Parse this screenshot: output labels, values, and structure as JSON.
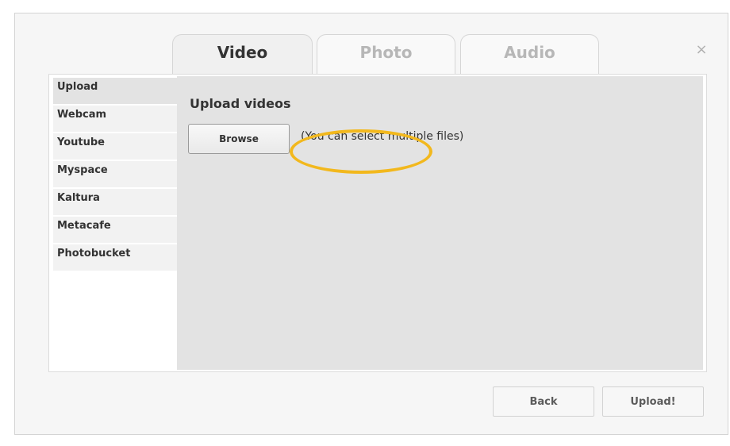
{
  "tabs": [
    {
      "label": "Video",
      "active": true
    },
    {
      "label": "Photo",
      "active": false
    },
    {
      "label": "Audio",
      "active": false
    }
  ],
  "close_symbol": "×",
  "sidebar": {
    "items": [
      {
        "label": "Upload",
        "active": true
      },
      {
        "label": "Webcam",
        "active": false
      },
      {
        "label": "Youtube",
        "active": false
      },
      {
        "label": "Myspace",
        "active": false
      },
      {
        "label": "Kaltura",
        "active": false
      },
      {
        "label": "Metacafe",
        "active": false
      },
      {
        "label": "Photobucket",
        "active": false
      }
    ]
  },
  "content": {
    "title": "Upload videos",
    "browse_label": "Browse",
    "hint": "(You can select multiple files)"
  },
  "footer": {
    "back_label": "Back",
    "upload_label": "Upload!"
  },
  "colors": {
    "highlight_ring": "#f2b81d",
    "panel_gray": "#e3e3e3"
  }
}
